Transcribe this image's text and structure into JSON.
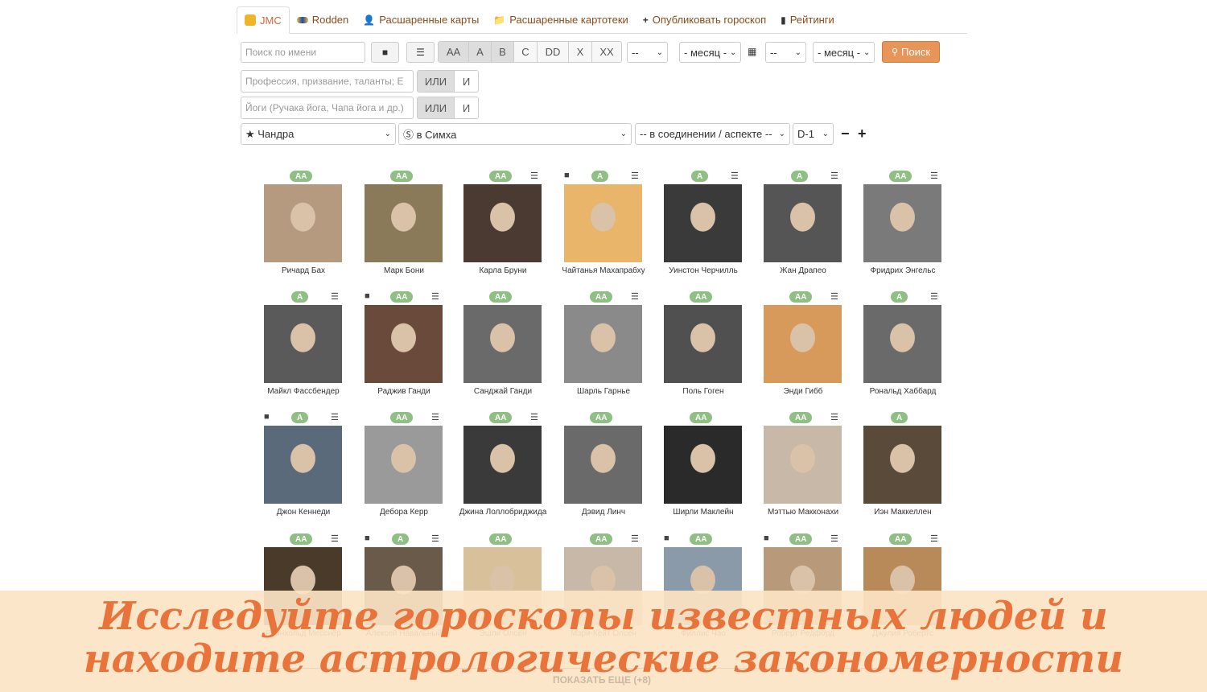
{
  "tabs": [
    {
      "label": "JMC",
      "icon": "jmc-logo-icon"
    },
    {
      "label": "Rodden",
      "icon": "rodden-logo-icon"
    },
    {
      "label": "Расшаренные карты",
      "icon": "user-icon"
    },
    {
      "label": "Расшаренные картотеки",
      "icon": "folder-icon"
    },
    {
      "label": "Опубликовать гороскоп",
      "icon": "plus-icon"
    },
    {
      "label": "Рейтинги",
      "icon": "bar-chart-icon"
    }
  ],
  "filters": {
    "name_placeholder": "Поиск по имени",
    "rating_options": [
      "AA",
      "A",
      "B",
      "C",
      "DD",
      "X",
      "XX"
    ],
    "day_from": "--",
    "month_from": "- месяц -",
    "day_to": "--",
    "month_to": "- месяц -",
    "search_label": "Поиск",
    "profession_placeholder": "Профессия, призвание, таланты; Е",
    "yoga_placeholder": "Йоги (Ручака йога, Чапа йога и др.)",
    "or_label": "ИЛИ",
    "and_label": "И",
    "planet": "★ Чандра",
    "sign": "Ⓢ в Симха",
    "aspect": "-- в соединении / аспекте --",
    "varga": "D-1",
    "minus": "−",
    "plus": "+"
  },
  "people": [
    {
      "name": "Ричард Бах",
      "rating": "AA",
      "comment": false,
      "list": false
    },
    {
      "name": "Марк Бони",
      "rating": "AA",
      "comment": false,
      "list": false
    },
    {
      "name": "Карла Бруни",
      "rating": "AA",
      "comment": false,
      "list": true
    },
    {
      "name": "Чайтанья Махапрабху",
      "rating": "A",
      "comment": true,
      "list": true
    },
    {
      "name": "Уинстон Черчилль",
      "rating": "A",
      "comment": false,
      "list": true
    },
    {
      "name": "Жан Драпео",
      "rating": "A",
      "comment": false,
      "list": true
    },
    {
      "name": "Фридрих Энгельс",
      "rating": "AA",
      "comment": false,
      "list": true
    },
    {
      "name": "Майкл Фассбендер",
      "rating": "A",
      "comment": false,
      "list": true
    },
    {
      "name": "Раджив Ганди",
      "rating": "AA",
      "comment": true,
      "list": true
    },
    {
      "name": "Санджай Ганди",
      "rating": "AA",
      "comment": false,
      "list": false
    },
    {
      "name": "Шарль Гарнье",
      "rating": "AA",
      "comment": false,
      "list": true
    },
    {
      "name": "Поль Гоген",
      "rating": "AA",
      "comment": false,
      "list": false
    },
    {
      "name": "Энди Гибб",
      "rating": "AA",
      "comment": false,
      "list": true
    },
    {
      "name": "Рональд Хаббард",
      "rating": "A",
      "comment": false,
      "list": true
    },
    {
      "name": "Джон Кеннеди",
      "rating": "A",
      "comment": true,
      "list": true
    },
    {
      "name": "Дебора Керр",
      "rating": "AA",
      "comment": false,
      "list": true
    },
    {
      "name": "Джина Лоллобриджида",
      "rating": "AA",
      "comment": false,
      "list": true
    },
    {
      "name": "Дэвид Линч",
      "rating": "AA",
      "comment": false,
      "list": false
    },
    {
      "name": "Ширли Маклейн",
      "rating": "AA",
      "comment": false,
      "list": false
    },
    {
      "name": "Мэттью Макконахи",
      "rating": "AA",
      "comment": false,
      "list": true
    },
    {
      "name": "Иэн Маккеллен",
      "rating": "A",
      "comment": false,
      "list": false
    },
    {
      "name": "Райнхольд Месснер",
      "rating": "AA",
      "comment": false,
      "list": true
    },
    {
      "name": "Алексей Навальный",
      "rating": "A",
      "comment": true,
      "list": true
    },
    {
      "name": "Эшли Олсен",
      "rating": "AA",
      "comment": false,
      "list": false
    },
    {
      "name": "Мэри-Кейт Олсен",
      "rating": "AA",
      "comment": false,
      "list": true
    },
    {
      "name": "Филлис Чао",
      "rating": "AA",
      "comment": true,
      "list": false
    },
    {
      "name": "Роберт Редфорд",
      "rating": "AA",
      "comment": true,
      "list": true
    },
    {
      "name": "Джулия Робертс",
      "rating": "AA",
      "comment": false,
      "list": true
    }
  ],
  "photo_colors": [
    "#b59a80",
    "#8a7a5a",
    "#4a3a32",
    "#e8b56a",
    "#3a3a3a",
    "#555",
    "#7a7a7a",
    "#5a5a5a",
    "#6a4a3a",
    "#6a6a6a",
    "#8a8a8a",
    "#505050",
    "#d89a5a",
    "#6a6a6a",
    "#5a6a7a",
    "#9a9a9a",
    "#3a3a3a",
    "#6a6a6a",
    "#2a2a2a",
    "#c8b8a8",
    "#5a4a3a",
    "#4a3a2a",
    "#6a5a4a",
    "#d8c09a",
    "#c8b8a8",
    "#8a9aa8",
    "#b89a7a",
    "#b88a5a"
  ],
  "banner": {
    "line1": "Исследуйте гороскопы известных людей и",
    "line2": "находите астрологические закономерности",
    "show_more": "ПОКАЗАТЬ ЕЩЕ (+8)"
  }
}
